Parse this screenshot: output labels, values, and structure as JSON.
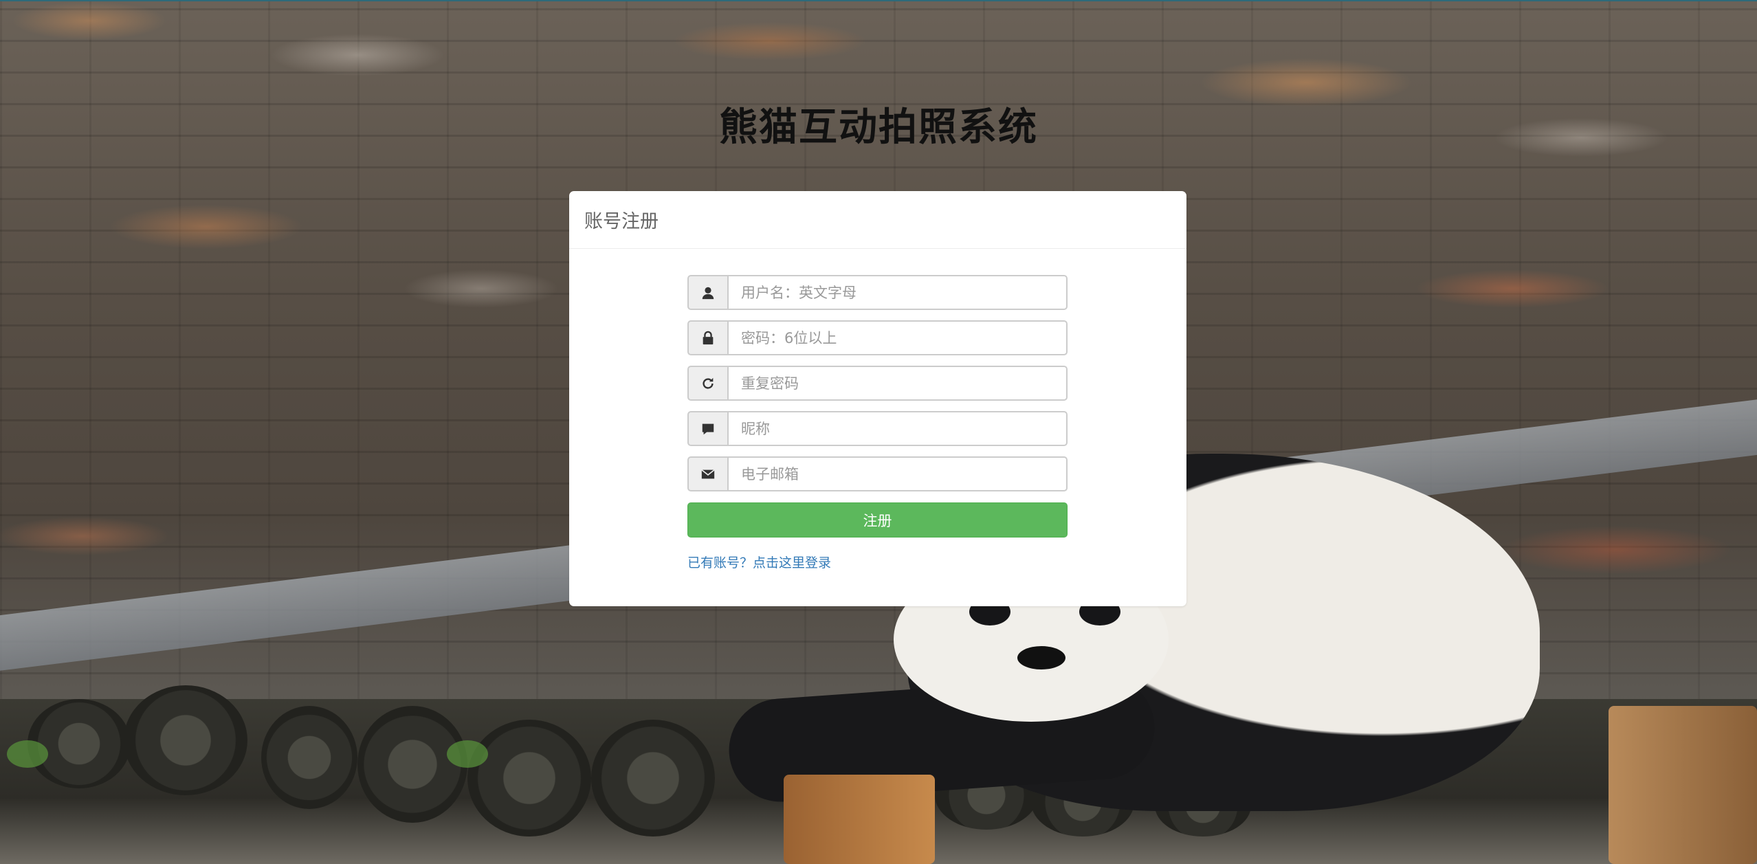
{
  "page": {
    "title": "熊猫互动拍照系统"
  },
  "panel": {
    "heading": "账号注册"
  },
  "form": {
    "fields": [
      {
        "icon": "user-icon",
        "placeholder": "用户名：英文字母",
        "value": ""
      },
      {
        "icon": "lock-icon",
        "placeholder": "密码：6位以上",
        "value": ""
      },
      {
        "icon": "refresh-icon",
        "placeholder": "重复密码",
        "value": ""
      },
      {
        "icon": "comment-icon",
        "placeholder": "昵称",
        "value": ""
      },
      {
        "icon": "envelope-icon",
        "placeholder": "电子邮箱",
        "value": ""
      }
    ],
    "submit_label": "注册",
    "login_link": "已有账号？点击这里登录"
  },
  "colors": {
    "primary_button": "#5cb85c",
    "link": "#337ab7",
    "addon_bg": "#eeeeee"
  }
}
